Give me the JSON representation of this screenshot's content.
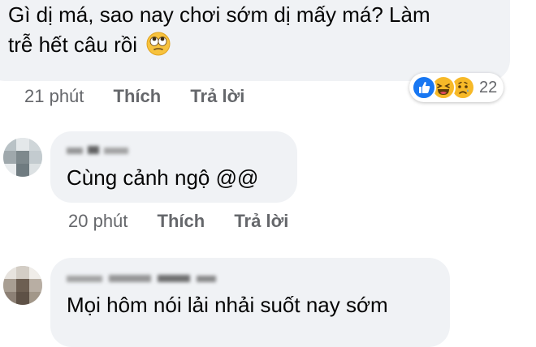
{
  "comments": [
    {
      "text_line1": "Gì dị má, sao nay chơi sớm dị mấy má? Làm",
      "text_line2": "trễ hết câu rồi",
      "emoji": "rolling-eyes-emoji",
      "time": "21 phút",
      "like_label": "Thích",
      "reply_label": "Trả lời",
      "reactions": {
        "icons": [
          "like-reaction-icon",
          "haha-reaction-icon",
          "sad-reaction-icon"
        ],
        "count": "22"
      }
    },
    {
      "author": "",
      "text": "Cùng cảnh ngộ @@",
      "time": "20 phút",
      "like_label": "Thích",
      "reply_label": "Trả lời"
    },
    {
      "author": "",
      "text": "Mọi hôm nói lải nhải suốt nay sớm"
    }
  ],
  "colors": {
    "bubble": "#f0f2f5",
    "meta_text": "#65676b",
    "like_blue": "#1877f2",
    "haha_yellow": "#f7b928"
  }
}
